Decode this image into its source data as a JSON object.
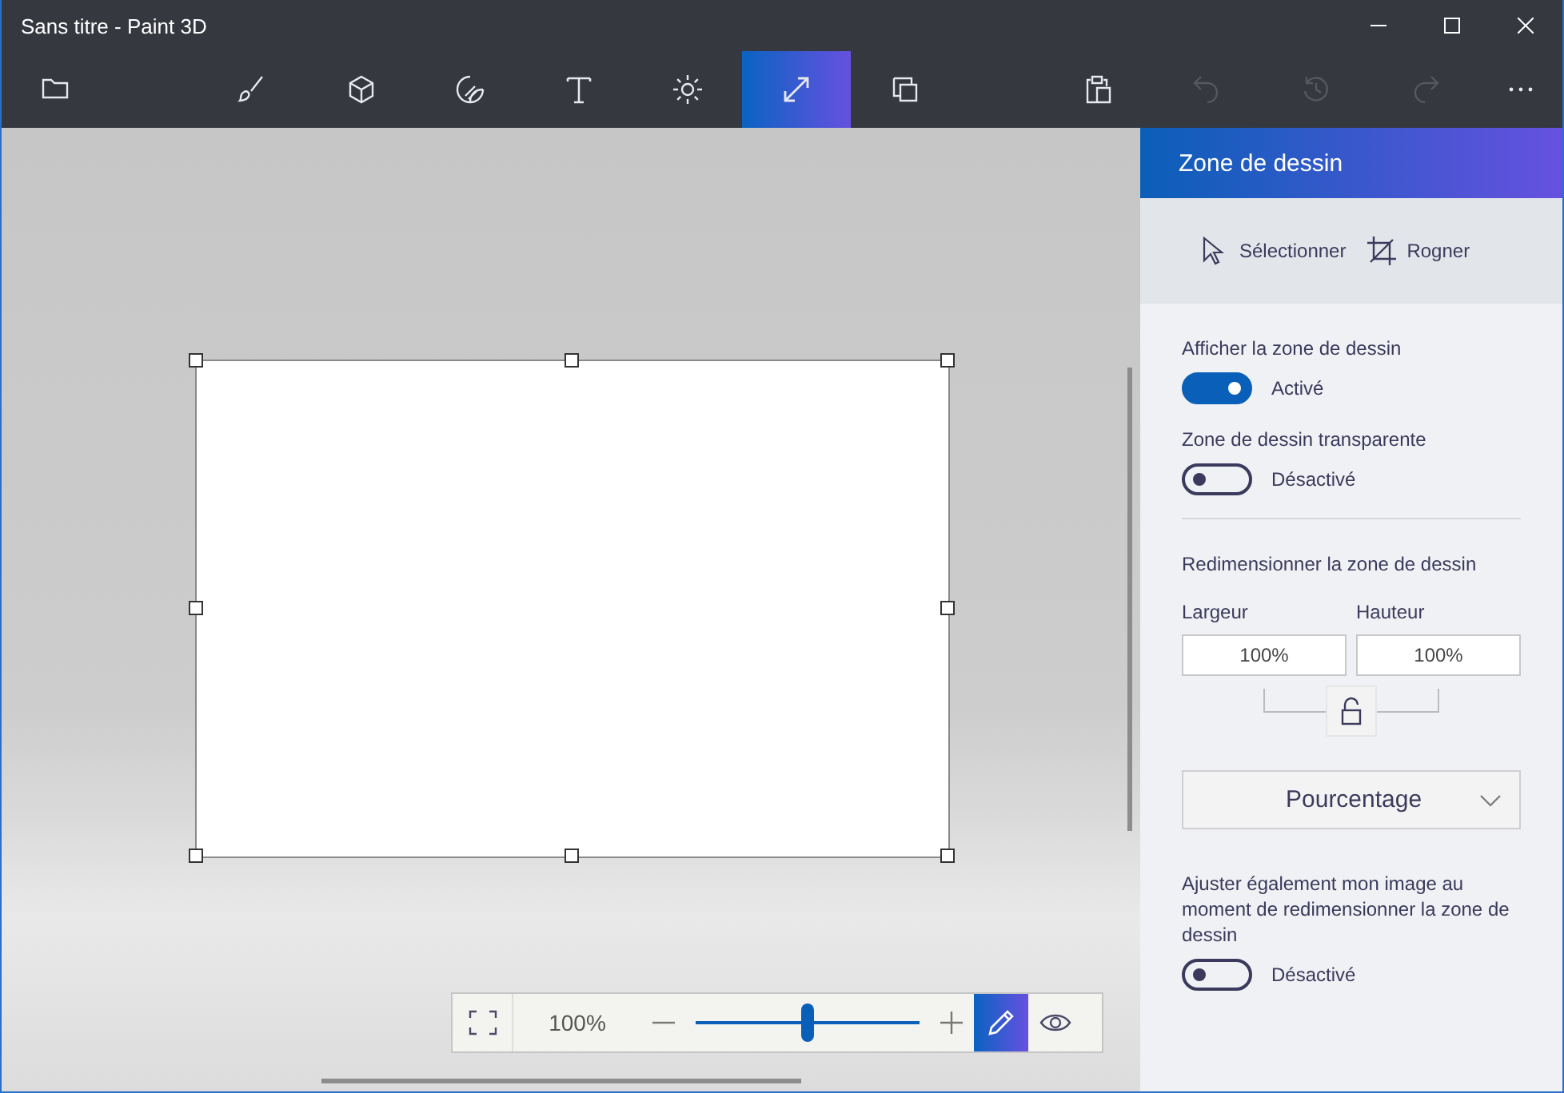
{
  "window": {
    "title": "Sans titre - Paint 3D"
  },
  "toolbar": {
    "tools": [
      {
        "kind": "folder",
        "selected": false
      },
      {
        "kind": "brush",
        "selected": false
      },
      {
        "kind": "cube",
        "selected": false
      },
      {
        "kind": "sticker",
        "selected": false
      },
      {
        "kind": "text",
        "selected": false
      },
      {
        "kind": "effects",
        "selected": false
      },
      {
        "kind": "canvas",
        "selected": true
      },
      {
        "kind": "library",
        "selected": false
      }
    ],
    "actions": [
      {
        "kind": "paste",
        "disabled": false
      },
      {
        "kind": "undo",
        "disabled": true
      },
      {
        "kind": "history",
        "disabled": true
      },
      {
        "kind": "redo",
        "disabled": true
      },
      {
        "kind": "more",
        "disabled": false
      }
    ]
  },
  "zoom_bar": {
    "value": "100%",
    "level": 0.5,
    "modes": [
      {
        "kind": "pencil",
        "selected": true
      },
      {
        "kind": "eye",
        "selected": false
      }
    ]
  },
  "panel": {
    "title": "Zone de dessin",
    "modes": [
      {
        "kind": "select",
        "label": "Sélectionner"
      },
      {
        "kind": "crop",
        "label": "Rogner"
      }
    ],
    "show_canvas": {
      "label": "Afficher la zone de dessin",
      "on": true,
      "state": "Activé"
    },
    "transparent": {
      "label": "Zone de dessin transparente",
      "on": false,
      "state": "Désactivé"
    },
    "resize": {
      "title": "Redimensionner la zone de dessin",
      "width": {
        "label": "Largeur",
        "value": "100%"
      },
      "height": {
        "label": "Hauteur",
        "value": "100%"
      },
      "locked": false,
      "unit": "Pourcentage"
    },
    "adjust_image": {
      "label": "Ajuster également mon image au moment de redimensionner la zone de dessin",
      "on": false,
      "state": "Désactivé"
    }
  }
}
